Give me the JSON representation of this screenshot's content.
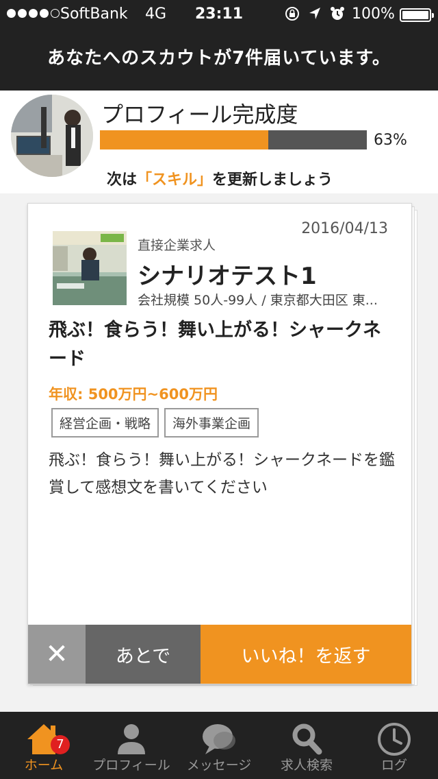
{
  "status_bar": {
    "carrier": "SoftBank",
    "network": "4G",
    "time": "23:11",
    "battery": "100%",
    "icons": [
      "orientation-lock-icon",
      "location-icon",
      "alarm-icon"
    ]
  },
  "header": {
    "banner": "あなたへのスカウトが7件届いています。"
  },
  "profile": {
    "title": "プロフィール完成度",
    "completion_percent": 63,
    "completion_label": "63%",
    "hint_prefix": "次は",
    "hint_highlight": "「スキル」",
    "hint_suffix": "を更新しましょう"
  },
  "card": {
    "date": "2016/04/13",
    "type": "直接企業求人",
    "company": "シナリオテスト1",
    "company_info": "会社規模 50人-99人 / 東京都大田区 東...",
    "job_title": "飛ぶ！食らう！舞い上がる！シャークネード",
    "salary": "年収: 500万円~600万円",
    "tags": [
      "経営企画・戦略",
      "海外事業企画"
    ],
    "description": "飛ぶ！食らう！舞い上がる！シャークネードを鑑賞して感想文を書いてください",
    "actions": {
      "dismiss": "✕",
      "later": "あとで",
      "like": "いいね！を返す"
    }
  },
  "tabbar": {
    "items": [
      {
        "label": "ホーム",
        "icon": "home-icon",
        "badge": "7",
        "active": true
      },
      {
        "label": "プロフィール",
        "icon": "person-icon",
        "active": false
      },
      {
        "label": "メッセージ",
        "icon": "chat-icon",
        "active": false
      },
      {
        "label": "求人検索",
        "icon": "search-icon",
        "active": false
      },
      {
        "label": "ログ",
        "icon": "clock-icon",
        "active": false
      }
    ]
  },
  "colors": {
    "accent": "#f09320",
    "dark": "#222222",
    "badge": "#e02020"
  }
}
